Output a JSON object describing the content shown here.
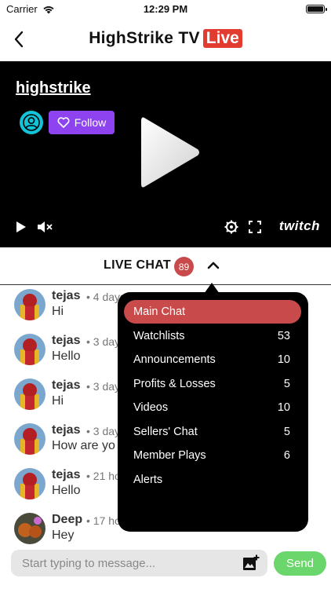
{
  "status_bar": {
    "carrier": "Carrier",
    "time": "12:29 PM"
  },
  "header": {
    "title": "HighStrike TV",
    "live_badge": "Live"
  },
  "video": {
    "channel_name": "highstrike",
    "follow_label": "Follow",
    "logo_text": "twitch"
  },
  "chat": {
    "title": "LIVE CHAT",
    "count": "89",
    "messages": [
      {
        "name": "tejas",
        "time": "• 4 days",
        "text": "Hi"
      },
      {
        "name": "tejas",
        "time": "• 3 day",
        "text": "Hello"
      },
      {
        "name": "tejas",
        "time": "• 3 day",
        "text": "Hi"
      },
      {
        "name": "tejas",
        "time": "• 3 day",
        "text": "How are yo"
      },
      {
        "name": "tejas",
        "time": "• 21 ho",
        "text": "Hello"
      },
      {
        "name": "Deep",
        "time": "• 17 ho",
        "text": "Hey"
      }
    ]
  },
  "dropdown": {
    "items": [
      {
        "label": "Main Chat",
        "count": ""
      },
      {
        "label": "Watchlists",
        "count": "53"
      },
      {
        "label": "Announcements",
        "count": "10"
      },
      {
        "label": "Profits & Losses",
        "count": "5"
      },
      {
        "label": "Videos",
        "count": "10"
      },
      {
        "label": "Sellers' Chat",
        "count": "5"
      },
      {
        "label": "Member Plays",
        "count": "6"
      },
      {
        "label": "Alerts",
        "count": ""
      }
    ]
  },
  "composer": {
    "placeholder": "Start typing to message...",
    "send_label": "Send"
  },
  "colors": {
    "live_red": "#e23b2f",
    "follow_purple": "#8e43f0",
    "badge_red": "#c84a4a",
    "send_green": "#6bd66b"
  }
}
